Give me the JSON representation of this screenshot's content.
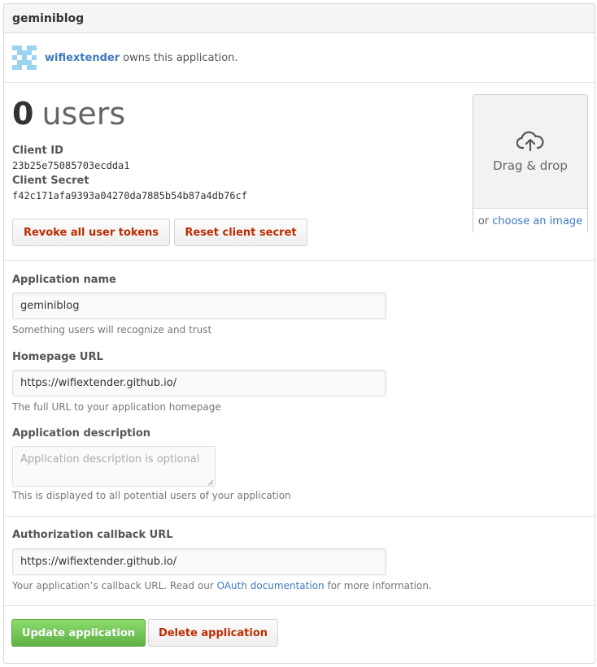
{
  "app": {
    "title": "geminiblog"
  },
  "owner": {
    "name": "wifiextender",
    "suffix": "owns this application."
  },
  "stats": {
    "users_count": "0",
    "users_label": "users",
    "client_id_label": "Client ID",
    "client_id": "23b25e75085703ecdda1",
    "client_secret_label": "Client Secret",
    "client_secret": "f42c171afa9393a04270da7885b54b87a4db76cf",
    "revoke_label": "Revoke all user tokens",
    "reset_label": "Reset client secret"
  },
  "dropzone": {
    "text": "Drag & drop",
    "or": "or",
    "link": "choose an image",
    "icon": "cloud-upload-icon"
  },
  "form": {
    "app_name_label": "Application name",
    "app_name_value": "geminiblog",
    "app_name_note": "Something users will recognize and trust",
    "homepage_label": "Homepage URL",
    "homepage_value": "https://wifiextender.github.io/",
    "homepage_note": "The full URL to your application homepage",
    "description_label": "Application description",
    "description_placeholder": "Application description is optional",
    "description_note": "This is displayed to all potential users of your application",
    "callback_label": "Authorization callback URL",
    "callback_value": "https://wifiextender.github.io/",
    "callback_note_pre": "Your application’s callback URL. Read our",
    "callback_note_link": "OAuth documentation",
    "callback_note_post": "for more information."
  },
  "actions": {
    "update_label": "Update application",
    "delete_label": "Delete application"
  },
  "colors": {
    "link": "#4078c0",
    "danger": "#bd2c00",
    "primary": "#6cc644"
  }
}
